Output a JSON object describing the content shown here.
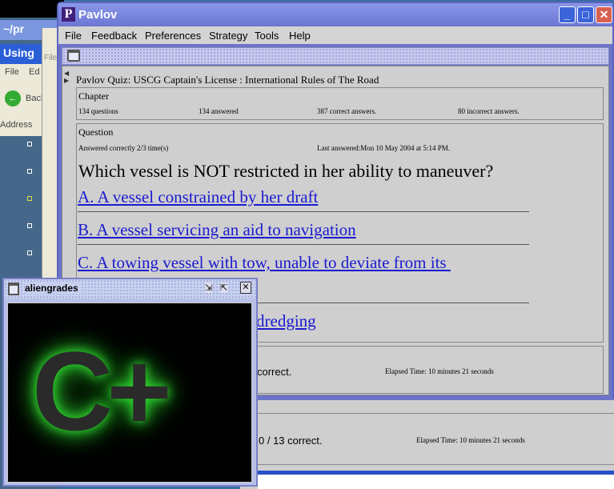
{
  "background": {
    "terminal_title": "~/pr",
    "ie_title": "Using",
    "ie_menu": [
      "File",
      "Ed"
    ],
    "ie_back": "Back",
    "ie_address": "Address",
    "paint_menu": "File"
  },
  "pavlov": {
    "title": "Pavlov",
    "logo_letter": "P",
    "menu": [
      "File",
      "Feedback",
      "Preferences",
      "Strategy",
      "Tools",
      "Help"
    ],
    "quiz_title": "Pavlov Quiz: USCG Captain's License : International Rules of The Road",
    "chapter": {
      "label": "Chapter",
      "questions": "134 questions",
      "answered": "134 answered",
      "correct": "387 correct answers.",
      "incorrect": "80 incorrect answers."
    },
    "question": {
      "label": "Question",
      "answered_correctly": "Answered correctly  2/3 time(s)",
      "last_answered": "Last answered:Mon 10 May 2004 at 5:14 PM.",
      "text": "Which vessel is NOT restricted in her ability to maneuver?",
      "answers": [
        "A. A vessel constrained by her draft",
        "B. A vessel servicing an aid to navigation",
        "C. A towing vessel with tow, unable to deviate from its ",
        "dredging"
      ]
    },
    "result": {
      "score": "correct.",
      "elapsed": "Elapsed Time:   10 minutes 21 seconds"
    }
  },
  "back_window": {
    "score": "0 / 13 correct.",
    "elapsed": "Elapsed Time:   10 minutes 21 seconds"
  },
  "aliengrades": {
    "title": "aliengrades",
    "grade": "C+"
  },
  "colors": {
    "title_bar": "#6c78d4",
    "link": "#1a1ad0",
    "glow": "#2fd82f"
  }
}
